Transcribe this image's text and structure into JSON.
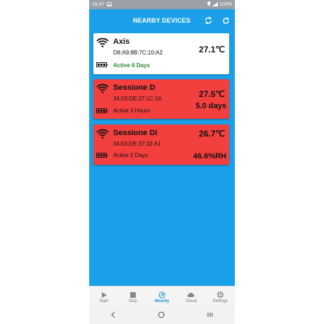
{
  "status_bar": {
    "time": "15:47",
    "battery": "100%"
  },
  "app_bar": {
    "title": "NEARBY DEVICES"
  },
  "devices": [
    {
      "name": "Axis",
      "mac": "D8:A9:8B:7C:10:A2",
      "status": "Active 6 Days",
      "temperature": "27.1℃",
      "extra": ""
    },
    {
      "name": "Sessione D",
      "mac": "34:03:DE:37:1C:16",
      "status": "Active 3 Hours",
      "temperature": "27.5℃",
      "extra": "5.0 days"
    },
    {
      "name": "Sessione Di",
      "mac": "34:03:DE:37:32:A1",
      "status": "Active 2 Days",
      "temperature": "26.7℃",
      "extra": "46.6%RH"
    }
  ],
  "bottom_nav": {
    "start": "Start",
    "stop": "Stop",
    "nearby": "Nearby",
    "cloud": "Cloud",
    "settings": "Settings"
  },
  "colors": {
    "background": "#1aa0e8",
    "alert_card": "#f43f3f",
    "active_text": "#2a8a2a",
    "nav_active": "#1a8fd6"
  },
  "icons": [
    "wifi-icon",
    "battery-icon",
    "sync-icon",
    "refresh-icon",
    "play-icon",
    "stop-icon",
    "nearby-icon",
    "cloud-icon",
    "gear-icon"
  ]
}
